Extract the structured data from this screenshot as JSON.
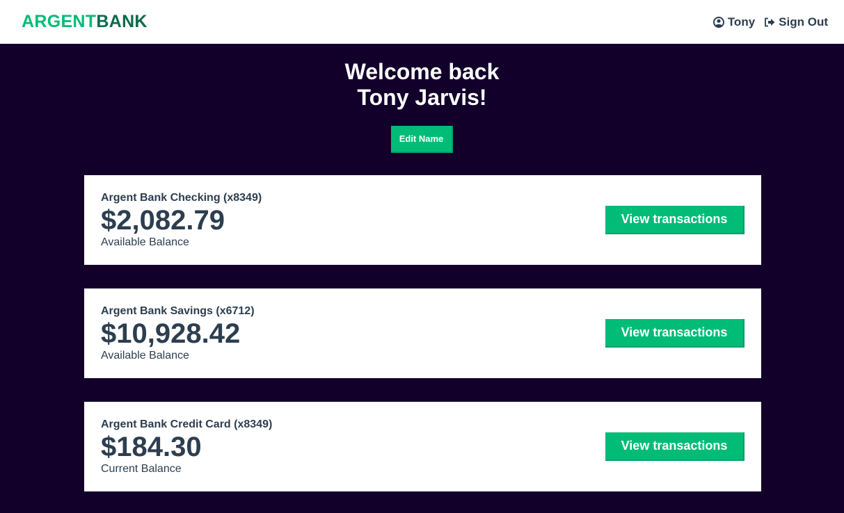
{
  "nav": {
    "logo_part1": "ARGENT",
    "logo_part2": "BANK",
    "user_label": "Tony",
    "signout_label": "Sign Out"
  },
  "header": {
    "line1": "Welcome back",
    "line2": "Tony Jarvis!",
    "edit_label": "Edit Name"
  },
  "accounts": [
    {
      "title": "Argent Bank Checking (x8349)",
      "amount": "$2,082.79",
      "description": "Available Balance",
      "button_label": "View transactions"
    },
    {
      "title": "Argent Bank Savings (x6712)",
      "amount": "$10,928.42",
      "description": "Available Balance",
      "button_label": "View transactions"
    },
    {
      "title": "Argent Bank Credit Card (x8349)",
      "amount": "$184.30",
      "description": "Current Balance",
      "button_label": "View transactions"
    }
  ],
  "colors": {
    "accent": "#00bc77",
    "background": "#12002b",
    "text": "#2c3e50"
  },
  "icons": {
    "user": "user-circle-icon",
    "signout": "sign-out-icon"
  }
}
